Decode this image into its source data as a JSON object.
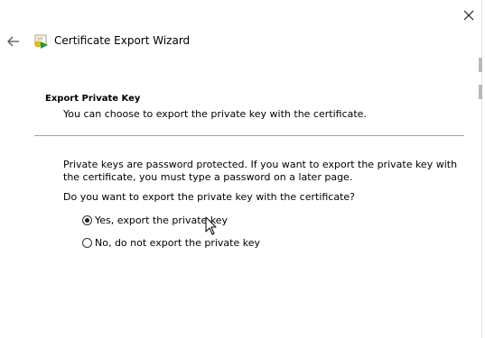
{
  "wizard": {
    "title": "Certificate Export Wizard",
    "back_icon": "back-arrow-icon",
    "close_icon": "close-icon",
    "app_icon": "certificate-wizard-icon"
  },
  "section": {
    "heading": "Export Private Key",
    "subtitle": "You can choose to export the private key with the certificate."
  },
  "body": {
    "paragraph": "Private keys are password protected. If you want to export the private key with the certificate, you must type a password on a later page.",
    "question": "Do you want to export the private key with the certificate?"
  },
  "options": [
    {
      "label": "Yes, export the private key",
      "checked": true
    },
    {
      "label": "No, do not export the private key",
      "checked": false
    }
  ],
  "colors": {
    "background": "#ffffff",
    "divider": "#a0a0a0",
    "text": "#000000"
  }
}
